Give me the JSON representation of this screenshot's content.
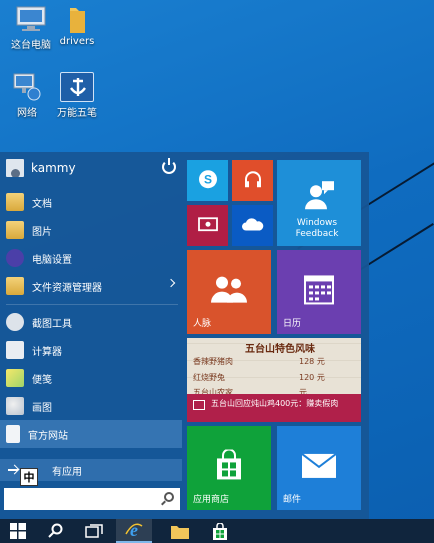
{
  "desktop": {
    "icons": [
      {
        "label": "这台电脑",
        "icon": "this-pc-icon"
      },
      {
        "label": "drivers",
        "icon": "folder-icon"
      },
      {
        "label": "网络",
        "icon": "network-icon"
      },
      {
        "label": "万能五笔",
        "icon": "wanneng-wubi-icon"
      }
    ]
  },
  "start_menu": {
    "user": {
      "name": "kammy"
    },
    "power_icon": "power-icon",
    "items": [
      {
        "label": "文档",
        "icon": "documents-icon"
      },
      {
        "label": "图片",
        "icon": "pictures-icon"
      },
      {
        "label": "电脑设置",
        "icon": "pc-settings-icon"
      },
      {
        "label": "文件资源管理器",
        "icon": "file-explorer-icon"
      },
      {
        "label": "截图工具",
        "icon": "snipping-tool-icon"
      },
      {
        "label": "计算器",
        "icon": "calculator-icon"
      },
      {
        "label": "便笺",
        "icon": "sticky-notes-icon"
      },
      {
        "label": "画图",
        "icon": "paint-icon"
      },
      {
        "label": "官方网站",
        "icon": "document-page-icon"
      }
    ],
    "all_apps": {
      "label": "所有应用",
      "visible_label": "有应用"
    },
    "ime_indicator": "中",
    "search": {
      "value": "",
      "placeholder": ""
    }
  },
  "tiles": {
    "skype": {
      "icon": "skype-icon",
      "color": "#1aa1e1"
    },
    "music": {
      "icon": "headphones-icon",
      "color": "#e04e2b"
    },
    "video": {
      "icon": "video-icon",
      "color": "#b01e45"
    },
    "onedrive": {
      "icon": "onedrive-icon",
      "color": "#0a5bc4"
    },
    "feedback": {
      "label": "Windows Feedback",
      "icon": "feedback-icon",
      "color": "#1e8fd8"
    },
    "people": {
      "label": "人脉",
      "icon": "people-icon",
      "color": "#d9532c"
    },
    "calendar": {
      "label": "日历",
      "icon": "calendar-icon",
      "color": "#6b3fb0"
    },
    "news": {
      "menu_title": "五台山特色风味",
      "menu_rows": [
        {
          "name": "香辣野猪肉",
          "price": "128 元"
        },
        {
          "name": "红烧野兔",
          "price": "120 元"
        },
        {
          "name": "五台山农家",
          "price": "元"
        }
      ],
      "headline": "五台山回应炖山鸡400元：赚卖假肉",
      "color": "#b0204a"
    },
    "store": {
      "label": "应用商店",
      "icon": "store-icon",
      "color": "#0fa23a"
    },
    "mail": {
      "label": "邮件",
      "icon": "mail-icon",
      "color": "#1e7fd8"
    }
  },
  "taskbar": {
    "buttons": [
      {
        "name": "start",
        "icon": "windows-logo-icon"
      },
      {
        "name": "search",
        "icon": "search-icon"
      },
      {
        "name": "task-view",
        "icon": "task-view-icon"
      },
      {
        "name": "internet-explorer",
        "icon": "ie-icon"
      },
      {
        "name": "file-explorer",
        "icon": "folder-icon"
      },
      {
        "name": "store",
        "icon": "store-icon"
      }
    ]
  }
}
